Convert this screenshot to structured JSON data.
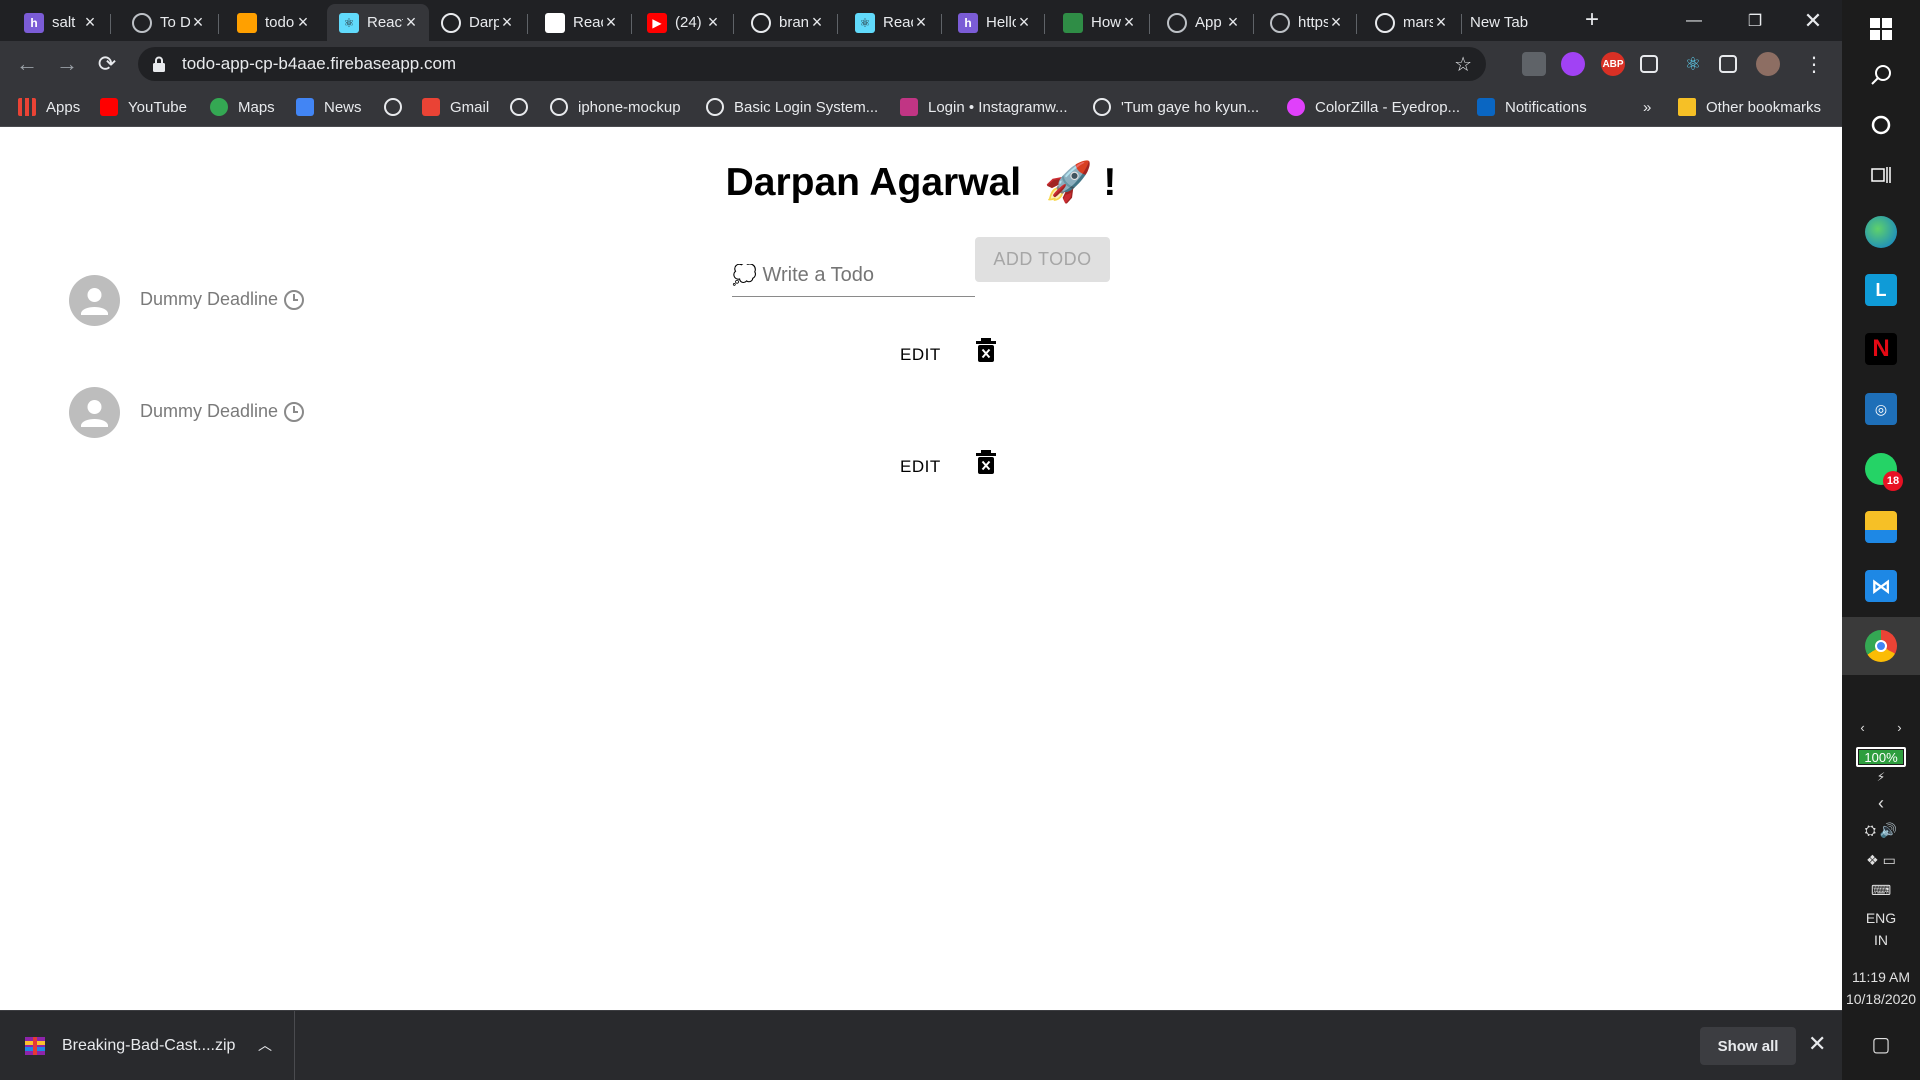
{
  "browser": {
    "tabs": [
      {
        "title": "salt",
        "favicon": "hashnode-icon",
        "color": "#7b5cd6",
        "letter": "h"
      },
      {
        "title": "To Do",
        "favicon": "globe-icon",
        "color": "#5f6368",
        "letter": ""
      },
      {
        "title": "todo",
        "favicon": "firebase-icon",
        "color": "#ffa000",
        "letter": ""
      },
      {
        "title": "React",
        "favicon": "react-icon",
        "color": "#61dafb",
        "letter": "⚛"
      },
      {
        "title": "Darpan",
        "favicon": "github-icon",
        "color": "#202124",
        "letter": ""
      },
      {
        "title": "React",
        "favicon": "notion-icon",
        "color": "#ffffff",
        "letter": ""
      },
      {
        "title": "(24)",
        "favicon": "youtube-icon",
        "color": "#ff0000",
        "letter": "▶"
      },
      {
        "title": "brand",
        "favicon": "github-icon",
        "color": "#202124",
        "letter": ""
      },
      {
        "title": "React",
        "favicon": "react-icon",
        "color": "#61dafb",
        "letter": "⚛"
      },
      {
        "title": "Hello",
        "favicon": "hashnode-icon",
        "color": "#7b5cd6",
        "letter": "h"
      },
      {
        "title": "How",
        "favicon": "geeksforgeeks-icon",
        "color": "#2f8d46",
        "letter": ""
      },
      {
        "title": "App",
        "favicon": "globe-icon",
        "color": "#5f6368",
        "letter": ""
      },
      {
        "title": "https://",
        "favicon": "globe-icon",
        "color": "#5f6368",
        "letter": ""
      },
      {
        "title": "mars/cr",
        "favicon": "github-icon",
        "color": "#202124",
        "letter": ""
      },
      {
        "title": "New Tab",
        "favicon": "",
        "color": "",
        "letter": ""
      }
    ],
    "active_tab_index": 3,
    "url": "todo-app-cp-b4aae.firebaseapp.com",
    "bookmarks": [
      {
        "label": "Apps",
        "icon": "apps-grid-icon",
        "color": "#ea4335"
      },
      {
        "label": "YouTube",
        "icon": "youtube-icon",
        "color": "#ff0000"
      },
      {
        "label": "Maps",
        "icon": "maps-icon",
        "color": "#34a853"
      },
      {
        "label": "News",
        "icon": "google-news-icon",
        "color": "#4285f4"
      },
      {
        "label": "",
        "icon": "globe-icon",
        "color": "#5f6368"
      },
      {
        "label": "Gmail",
        "icon": "gmail-icon",
        "color": "#ea4335"
      },
      {
        "label": "",
        "icon": "github-icon",
        "color": "#202124"
      },
      {
        "label": "iphone-mockup",
        "icon": "globe-icon",
        "color": "#5f6368"
      },
      {
        "label": "Basic Login System...",
        "icon": "code-icon",
        "color": "#5f6368"
      },
      {
        "label": "Login • Instagramw...",
        "icon": "instagram-icon",
        "color": "#c13584"
      },
      {
        "label": "'Tum gaye ho kyun...",
        "icon": "globe-icon",
        "color": "#5f6368"
      },
      {
        "label": "ColorZilla - Eyedrop...",
        "icon": "colorzilla-icon",
        "color": "#e040fb"
      },
      {
        "label": "Notifications",
        "icon": "linkedin-icon",
        "color": "#0a66c2"
      }
    ],
    "bookmarks_overflow": "»",
    "other_bookmarks": "Other bookmarks",
    "extensions": [
      {
        "icon": "puzzle-ext-icon",
        "color": "#5f6368",
        "label": ""
      },
      {
        "icon": "sync-ext-icon",
        "color": "#a142f4",
        "label": ""
      },
      {
        "icon": "adblock-plus-icon",
        "color": "#d93025",
        "label": "ABP"
      },
      {
        "icon": "eyedropper-ext-icon",
        "color": "#35363a",
        "label": ""
      },
      {
        "icon": "react-devtools-icon",
        "color": "#35363a",
        "label": "⚛"
      },
      {
        "icon": "extensions-puzzle-icon",
        "color": "#35363a",
        "label": ""
      },
      {
        "icon": "profile-avatar-icon",
        "color": "#8d6e63",
        "label": ""
      }
    ]
  },
  "app": {
    "title": "Darpan Agarwal",
    "title_emoji": "🚀",
    "title_suffix": "!",
    "input_placeholder": "💭 Write a Todo",
    "add_button_label": "ADD TODO",
    "todos": [
      {
        "text": "Dummy Deadline",
        "edit_label": "EDIT"
      },
      {
        "text": "Dummy Deadline",
        "edit_label": "EDIT"
      }
    ]
  },
  "downloads": {
    "file_name": "Breaking-Bad-Cast....zip",
    "show_all_label": "Show all"
  },
  "taskbar": {
    "battery_percent": 100,
    "battery_label": "100%",
    "language_line1": "ENG",
    "language_line2": "IN",
    "time": "11:19 AM",
    "date": "10/18/2020",
    "whatsapp_badge": "18"
  }
}
